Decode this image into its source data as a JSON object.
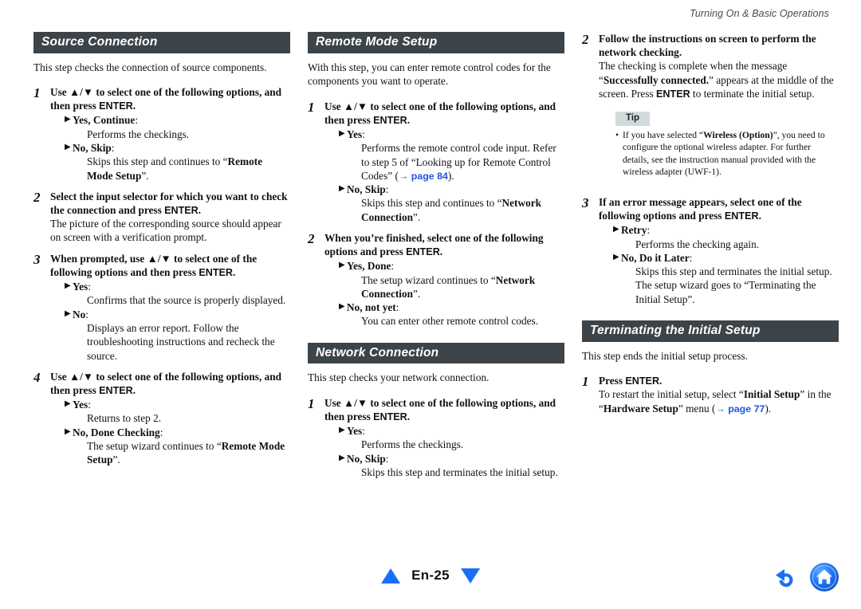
{
  "header": {
    "running_title": "Turning On & Basic Operations"
  },
  "colors": {
    "section_bar_bg": "#3d4449",
    "link_blue": "#2255dd",
    "nav_blue": "#1a6ef5",
    "tip_bg": "#d3dadb"
  },
  "arrow_glyph": "▶",
  "updown_glyph": "▲/▼",
  "columns": [
    {
      "sections": [
        {
          "title": "Source Connection",
          "intro": "This step checks the connection of source components.",
          "steps": [
            {
              "num": "1",
              "title_parts": [
                {
                  "t": "Use ",
                  "bold": true
                },
                {
                  "t": "▲/▼",
                  "bold": true
                },
                {
                  "t": " to select one of the following options, and then press ",
                  "bold": true
                },
                {
                  "t": "ENTER",
                  "sans": true
                },
                {
                  "t": ".",
                  "bold": true
                }
              ],
              "options": [
                {
                  "label": "Yes, Continue",
                  "text_parts": [
                    {
                      "t": "Performs the checkings."
                    }
                  ]
                },
                {
                  "label": "No, Skip",
                  "text_parts": [
                    {
                      "t": "Skips this step and continues to “"
                    },
                    {
                      "t": "Remote Mode Setup",
                      "bold": true
                    },
                    {
                      "t": "”."
                    }
                  ]
                }
              ]
            },
            {
              "num": "2",
              "title_parts": [
                {
                  "t": "Select the input selector for which you want to check the connection and press ",
                  "bold": true
                },
                {
                  "t": "ENTER",
                  "sans": true
                },
                {
                  "t": ".",
                  "bold": true
                }
              ],
              "desc": "The picture of the corresponding source should appear on screen with a verification prompt.",
              "options": []
            },
            {
              "num": "3",
              "title_parts": [
                {
                  "t": "When prompted, use ",
                  "bold": true
                },
                {
                  "t": "▲/▼",
                  "bold": true
                },
                {
                  "t": " to select one of the following options and then press ",
                  "bold": true
                },
                {
                  "t": "ENTER",
                  "sans": true
                },
                {
                  "t": ".",
                  "bold": true
                }
              ],
              "options": [
                {
                  "label": "Yes",
                  "text_parts": [
                    {
                      "t": "Confirms that the source is properly displayed."
                    }
                  ]
                },
                {
                  "label": "No",
                  "text_parts": [
                    {
                      "t": "Displays an error report. Follow the troubleshooting instructions and recheck the source."
                    }
                  ]
                }
              ]
            },
            {
              "num": "4",
              "title_parts": [
                {
                  "t": "Use ",
                  "bold": true
                },
                {
                  "t": "▲/▼",
                  "bold": true
                },
                {
                  "t": " to select one of the following options, and then press ",
                  "bold": true
                },
                {
                  "t": "ENTER",
                  "sans": true
                },
                {
                  "t": ".",
                  "bold": true
                }
              ],
              "options": [
                {
                  "label": "Yes",
                  "text_parts": [
                    {
                      "t": "Returns to step 2."
                    }
                  ]
                },
                {
                  "label": "No, Done Checking",
                  "text_parts": [
                    {
                      "t": "The setup wizard continues to “"
                    },
                    {
                      "t": "Remote Mode Setup",
                      "bold": true
                    },
                    {
                      "t": "”."
                    }
                  ]
                }
              ]
            }
          ]
        }
      ]
    },
    {
      "sections": [
        {
          "title": "Remote Mode Setup",
          "intro": "With this step, you can enter remote control codes for the components you want to operate.",
          "steps": [
            {
              "num": "1",
              "title_parts": [
                {
                  "t": "Use ",
                  "bold": true
                },
                {
                  "t": "▲/▼",
                  "bold": true
                },
                {
                  "t": " to select one of the following options, and then press ",
                  "bold": true
                },
                {
                  "t": "ENTER",
                  "sans": true
                },
                {
                  "t": ".",
                  "bold": true
                }
              ],
              "options": [
                {
                  "label": "Yes",
                  "text_parts": [
                    {
                      "t": "Performs the remote control code input. Refer to step 5 of “Looking up for Remote Control Codes” ("
                    },
                    {
                      "t": "→ page 84",
                      "link": true
                    },
                    {
                      "t": ")."
                    }
                  ]
                },
                {
                  "label": "No, Skip",
                  "text_parts": [
                    {
                      "t": "Skips this step and continues to “"
                    },
                    {
                      "t": "Network Connection",
                      "bold": true
                    },
                    {
                      "t": "”."
                    }
                  ]
                }
              ]
            },
            {
              "num": "2",
              "title_parts": [
                {
                  "t": "When you’re finished, select one of the following options and press ",
                  "bold": true
                },
                {
                  "t": "ENTER",
                  "sans": true
                },
                {
                  "t": ".",
                  "bold": true
                }
              ],
              "options": [
                {
                  "label": "Yes, Done",
                  "text_parts": [
                    {
                      "t": "The setup wizard continues to “"
                    },
                    {
                      "t": "Network Connection",
                      "bold": true
                    },
                    {
                      "t": "”."
                    }
                  ]
                },
                {
                  "label": "No, not yet",
                  "text_parts": [
                    {
                      "t": "You can enter other remote control codes."
                    }
                  ]
                }
              ]
            }
          ]
        },
        {
          "title": "Network Connection",
          "title_margin_top": true,
          "intro": "This step checks your network connection.",
          "steps": [
            {
              "num": "1",
              "title_parts": [
                {
                  "t": "Use ",
                  "bold": true
                },
                {
                  "t": "▲/▼",
                  "bold": true
                },
                {
                  "t": " to select one of the following options, and then press ",
                  "bold": true
                },
                {
                  "t": "ENTER",
                  "sans": true
                },
                {
                  "t": ".",
                  "bold": true
                }
              ],
              "options": [
                {
                  "label": "Yes",
                  "text_parts": [
                    {
                      "t": "Performs the checkings."
                    }
                  ]
                },
                {
                  "label": "No, Skip",
                  "text_parts": [
                    {
                      "t": "Skips this step and terminates the initial setup."
                    }
                  ]
                }
              ]
            }
          ]
        }
      ]
    },
    {
      "sections": [
        {
          "title": null,
          "intro": null,
          "steps": [
            {
              "num": "2",
              "title_parts": [
                {
                  "t": "Follow the instructions on screen to perform the network checking.",
                  "bold": true
                }
              ],
              "desc_parts": [
                {
                  "t": "The checking is complete when the message “"
                },
                {
                  "t": "Successfully connected.",
                  "bold": true
                },
                {
                  "t": "” appears at the middle of the screen. Press "
                },
                {
                  "t": "ENTER",
                  "sans": true
                },
                {
                  "t": " to terminate the initial setup."
                }
              ],
              "tip": {
                "badge": "Tip",
                "items": [
                  {
                    "parts": [
                      {
                        "t": "If you have selected “"
                      },
                      {
                        "t": "Wireless (Option)",
                        "bold": true
                      },
                      {
                        "t": "”, you need to configure the optional wireless adapter. For further details, see the instruction manual provided with the wireless adapter (UWF-1)."
                      }
                    ]
                  }
                ]
              },
              "options": []
            },
            {
              "num": "3",
              "title_parts": [
                {
                  "t": "If an error message appears, select one of the following options and press ",
                  "bold": true
                },
                {
                  "t": "ENTER",
                  "sans": true
                },
                {
                  "t": ".",
                  "bold": true
                }
              ],
              "options": [
                {
                  "label": "Retry",
                  "text_parts": [
                    {
                      "t": "Performs the checking again."
                    }
                  ]
                },
                {
                  "label": "No, Do it Later",
                  "text_parts": [
                    {
                      "t": "Skips this step and terminates the initial setup. The setup wizard goes to “Terminating the Initial Setup”."
                    }
                  ]
                }
              ]
            }
          ]
        },
        {
          "title": "Terminating the Initial Setup",
          "title_margin_top": true,
          "intro": "This step ends the initial setup process.",
          "steps": [
            {
              "num": "1",
              "title_parts": [
                {
                  "t": "Press ",
                  "bold": true
                },
                {
                  "t": "ENTER",
                  "sans": true
                },
                {
                  "t": ".",
                  "bold": true
                }
              ],
              "desc_parts": [
                {
                  "t": "To restart the initial setup, select “"
                },
                {
                  "t": "Initial Setup",
                  "bold": true
                },
                {
                  "t": "” in the “"
                },
                {
                  "t": "Hardware Setup",
                  "bold": true
                },
                {
                  "t": "” menu ("
                },
                {
                  "t": "→ page 77",
                  "link": true
                },
                {
                  "t": ")."
                }
              ],
              "options": []
            }
          ]
        }
      ]
    }
  ],
  "footer": {
    "page_label": "En-25",
    "prev_icon": "triangle-up-icon",
    "next_icon": "triangle-down-icon",
    "back_icon": "back-arrow-icon",
    "home_icon": "home-icon"
  }
}
